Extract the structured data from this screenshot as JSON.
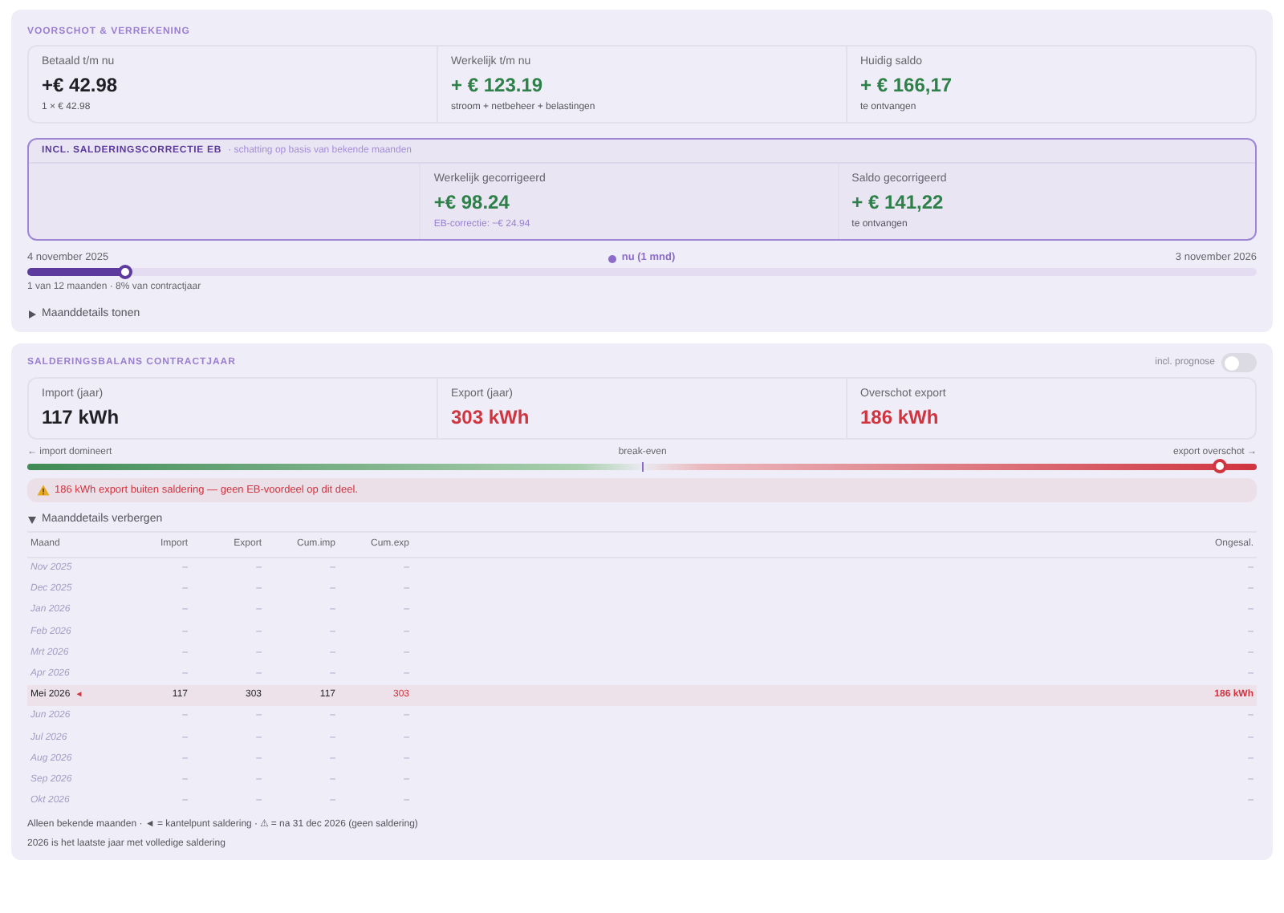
{
  "voorschot": {
    "title": "VOORSCHOT & VERREKENING",
    "cards": [
      {
        "label": "Betaald t/m nu",
        "value": "+€ 42.98",
        "sub": "1 × € 42.98",
        "color": "#1f1f24"
      },
      {
        "label": "Werkelijk t/m nu",
        "value": "+ € 123.19",
        "sub": "stroom + netbeheer + belastingen",
        "color": "#2e8049"
      },
      {
        "label": "Huidig saldo",
        "value": "+ € 166,17",
        "sub": "te ontvangen",
        "color": "#2e8049"
      }
    ],
    "correction": {
      "title": "INCL. SALDERINGSCORRECTIE EB",
      "subtitle": "· schatting op basis van bekende maanden",
      "cards": [
        {
          "kind": "empty"
        },
        {
          "kind": "adjustment",
          "label": "Werkelijk gecorrigeerd",
          "value": "+€ 98.24",
          "sub": "EB-correctie: −€ 24.94",
          "color": "#2e8049"
        },
        {
          "kind": "value",
          "label": "Saldo gecorrigeerd",
          "value": "+ € 141,22",
          "sub": "te ontvangen",
          "color": "#2e8049"
        }
      ]
    },
    "progress": {
      "start": "4 november 2025",
      "now": "nu (1 mnd)",
      "end": "3 november 2026",
      "level": 0.08,
      "caption": "1 van 12 maanden · 8% van contractjaar"
    },
    "details_toggle": {
      "label": "Maanddetails tonen",
      "expanded": false
    }
  },
  "saldering": {
    "title": "SALDERINGSBALANS CONTRACTJAAR",
    "toggle": {
      "label": "incl. prognose",
      "on": false
    },
    "cards": [
      {
        "label": "Import (jaar)",
        "value": "117 kWh",
        "color": "#1f1f24"
      },
      {
        "label": "Export (jaar)",
        "value": "303 kWh",
        "color": "#d0343f"
      },
      {
        "label": "Overschot export",
        "value": "186 kWh",
        "color": "#d0343f"
      }
    ],
    "balance": {
      "left": "← import domineert",
      "middle": "break-even",
      "right": "export overschot →",
      "level": 0.97
    },
    "warning": {
      "text": "186 kWh export buiten saldering — geen EB-voordeel op dit deel."
    },
    "details_toggle": {
      "label": "Maanddetails verbergen",
      "expanded": true
    },
    "table": {
      "columns": [
        "Maand",
        "Import",
        "Export",
        "Cum.imp",
        "Cum.exp",
        "Ongesal."
      ],
      "rows": [
        {
          "cells": [
            "Nov 2025",
            "–",
            "–",
            "–",
            "–",
            "–"
          ],
          "known": false,
          "highlighted": false
        },
        {
          "cells": [
            "Dec 2025",
            "–",
            "–",
            "–",
            "–",
            "–"
          ],
          "known": false,
          "highlighted": false
        },
        {
          "cells": [
            "Jan 2026",
            "–",
            "–",
            "–",
            "–",
            "–"
          ],
          "known": false,
          "highlighted": false
        },
        {
          "cells": [
            "Feb 2026",
            "–",
            "–",
            "–",
            "–",
            "–"
          ],
          "known": false,
          "highlighted": false
        },
        {
          "cells": [
            "Mrt 2026",
            "–",
            "–",
            "–",
            "–",
            "–"
          ],
          "known": false,
          "highlighted": false
        },
        {
          "cells": [
            "Apr 2026",
            "–",
            "–",
            "–",
            "–",
            "–"
          ],
          "known": false,
          "highlighted": false
        },
        {
          "cells": [
            "Mei 2026",
            "117",
            "303",
            "117",
            "303",
            "186 kWh"
          ],
          "marker": "◄",
          "known": true,
          "highlighted": true
        },
        {
          "cells": [
            "Jun 2026",
            "–",
            "–",
            "–",
            "–",
            "–"
          ],
          "known": false,
          "highlighted": false
        },
        {
          "cells": [
            "Jul 2026",
            "–",
            "–",
            "–",
            "–",
            "–"
          ],
          "known": false,
          "highlighted": false
        },
        {
          "cells": [
            "Aug 2026",
            "–",
            "–",
            "–",
            "–",
            "–"
          ],
          "known": false,
          "highlighted": false
        },
        {
          "cells": [
            "Sep 2026",
            "–",
            "–",
            "–",
            "–",
            "–"
          ],
          "known": false,
          "highlighted": false
        },
        {
          "cells": [
            "Okt 2026",
            "–",
            "–",
            "–",
            "–",
            "–"
          ],
          "known": false,
          "highlighted": false
        }
      ]
    },
    "footnotes": [
      "Alleen bekende maanden · ◄ = kantelpunt saldering · ⚠ = na 31 dec 2026 (geen saldering)",
      "2026 is het laatste jaar met volledige saldering"
    ]
  }
}
